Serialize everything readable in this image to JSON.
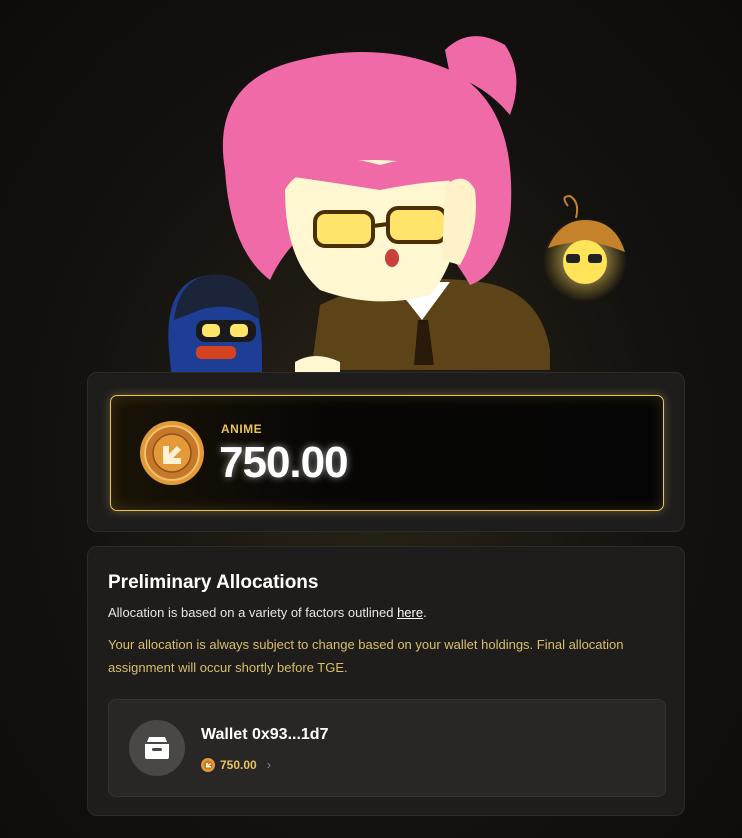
{
  "balance": {
    "token_label": "ANIME",
    "amount": "750.00"
  },
  "allocations": {
    "title": "Preliminary Allocations",
    "description_prefix": "Allocation is based on a variety of factors outlined ",
    "description_link": "here",
    "description_suffix": ".",
    "warning": "Your allocation is always subject to change based on your wallet holdings. Final allocation assignment will occur shortly before TGE.",
    "wallets": [
      {
        "name": "Wallet 0x93...1d7",
        "amount": "750.00"
      }
    ]
  },
  "icons": {
    "coin": "anime-coin-icon",
    "wallet": "wallet-icon",
    "chevron": "chevron-right-icon"
  },
  "colors": {
    "accent_gold": "#e8c45a",
    "warning_text": "#d9bf6d",
    "card_bg": "#1e1d1c"
  }
}
